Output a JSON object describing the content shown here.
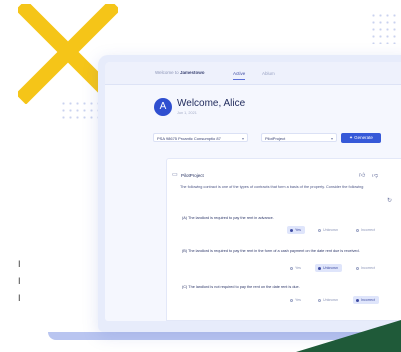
{
  "header": {
    "org_prefix": "Welcome to",
    "org_name": "Jamestowo",
    "tabs": [
      "Active",
      "Ablum"
    ]
  },
  "user": {
    "avatar_initial": "A",
    "greeting": "Welcome, Alice",
    "date": "Jun 1, 2021"
  },
  "controls": {
    "property_select": "PSA 98675 Proantic Consumptio 87",
    "project_select": "PilotProject",
    "generate_label": "Generate"
  },
  "project": {
    "title": "PilotProject",
    "description": "The following contract is one of the types of contracts that form a basis of the property. Consider the following",
    "questions": [
      {
        "text": "(A) The landlord is required to pay the rent in advance.",
        "options": [
          "Yes",
          "Unknown",
          "Incorrect"
        ],
        "selected": 0
      },
      {
        "text": "(B) The landlord is required to pay the rent in the form of a cash payment on the date rent due is received.",
        "options": [
          "Yes",
          "Unknown",
          "Incorrect"
        ],
        "selected": 1
      },
      {
        "text": "(C) The landlord is not required to pay the rent on the date rent is due.",
        "options": [
          "Yes",
          "Unknown",
          "Incorrect"
        ],
        "selected": 2
      }
    ]
  },
  "side_marks": [
    "I",
    "I",
    "I"
  ],
  "colors": {
    "accent": "#3659d8",
    "deco_yellow": "#f5c518",
    "deco_green": "#1f5a39",
    "laptop_body": "#e7ecfb"
  }
}
